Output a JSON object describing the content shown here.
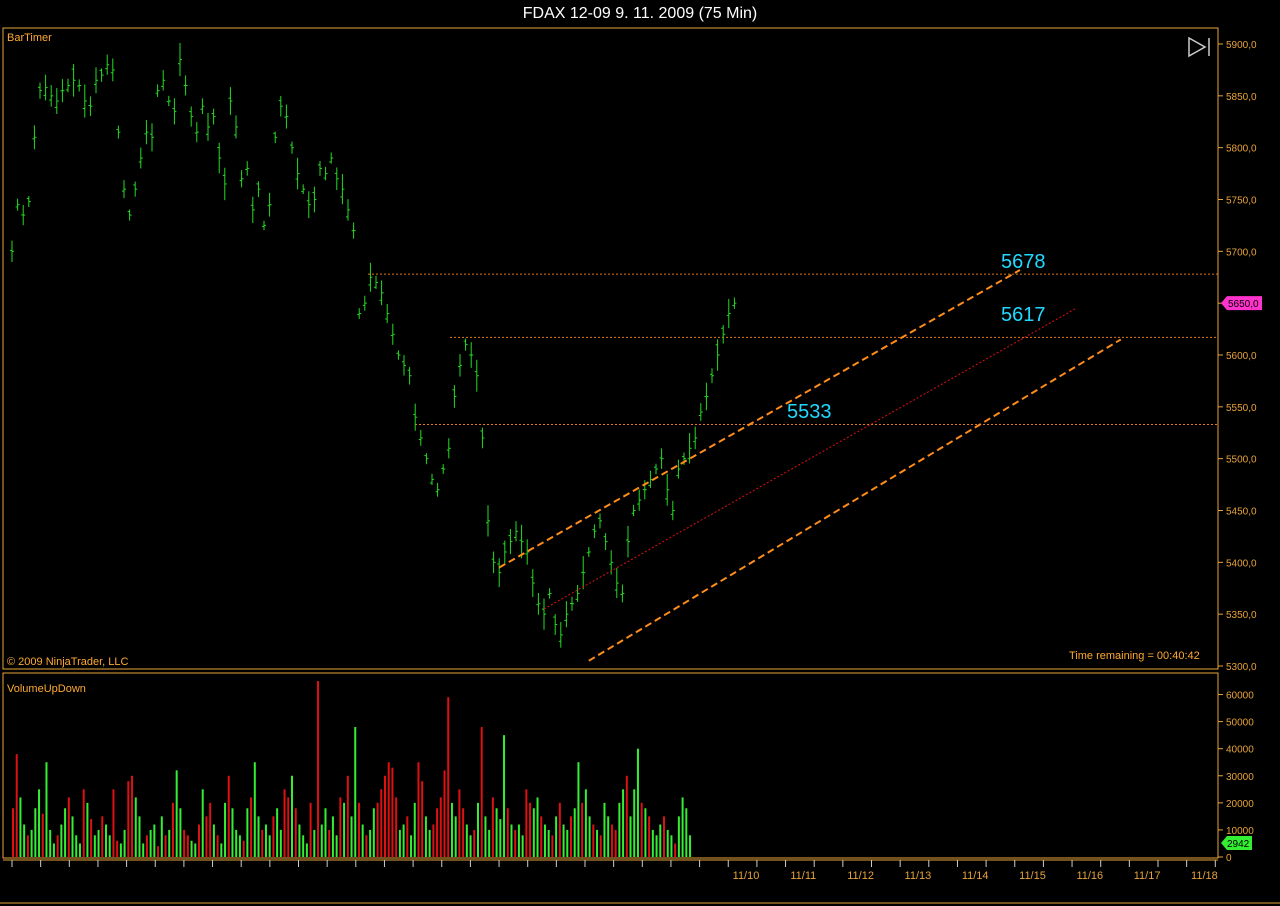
{
  "window": {
    "title": "FDAX 12-09  9. 11. 2009 (75 Min)"
  },
  "price_panel": {
    "indicator_label": "BarTimer",
    "copyright": "© 2009 NinjaTrader, LLC",
    "time_remaining": "Time remaining = 00:40:42",
    "current_price_marker": "5650,0",
    "level_labels": [
      "5678",
      "5617",
      "5533"
    ]
  },
  "volume_panel": {
    "indicator_label": "VolumeUpDown",
    "current_volume_marker": "2942"
  },
  "colors": {
    "up_bar": "#33ee33",
    "down_bar": "#dd1111",
    "price_line": "#22dd22",
    "axis": "#e8a33a",
    "level_line": "#e07a20",
    "channel": "#ff8c1a",
    "midline": "#dd1111",
    "level_label": "#22d8ff",
    "price_marker": "#ff33cc",
    "volume_marker": "#33ee33"
  },
  "icons": {
    "bar_timer_button": "play-to-end-icon"
  },
  "chart_data": [
    {
      "type": "line",
      "series": [
        {
          "values": [
            5700,
            5745,
            5735,
            5748,
            5810,
            5855,
            5858,
            5850,
            5845,
            5855,
            5860,
            5865,
            5860,
            5845,
            5840,
            5865,
            5870,
            5880,
            5875,
            5815,
            5760,
            5735,
            5760,
            5790,
            5815,
            5810,
            5855,
            5865,
            5845,
            5835,
            5885,
            5860,
            5830,
            5815,
            5840,
            5820,
            5830,
            5790,
            5765,
            5845,
            5820,
            5770,
            5780,
            5740,
            5760,
            5725,
            5745,
            5810,
            5840,
            5830,
            5800,
            5775,
            5760,
            5745,
            5750,
            5780,
            5775,
            5790,
            5770,
            5760,
            5740,
            5720,
            5640,
            5650,
            5675,
            5670,
            5660,
            5640,
            5620,
            5600,
            5590,
            5580,
            5540,
            5520,
            5500,
            5480,
            5470,
            5490,
            5510,
            5560,
            5590,
            5610,
            5600,
            5580,
            5520,
            5440,
            5400,
            5390,
            5410,
            5420,
            5430,
            5420,
            5410,
            5380,
            5360,
            5350,
            5370,
            5340,
            5330,
            5350,
            5360,
            5370,
            5390,
            5410,
            5430,
            5440,
            5420,
            5400,
            5380,
            5370,
            5420,
            5450,
            5460,
            5470,
            5480,
            5490,
            5500,
            5470,
            5450,
            5490,
            5500,
            5510,
            5520,
            5545,
            5560,
            5580,
            5600,
            5620,
            5640,
            5650
          ]
        }
      ],
      "ylim": [
        5300,
        5900
      ],
      "y_ticks": [
        "5900,0",
        "5850,0",
        "5800,0",
        "5750,0",
        "5700,0",
        "5650,0",
        "5600,0",
        "5550,0",
        "5500,0",
        "5450,0",
        "5400,0",
        "5350,0",
        "5300,0"
      ],
      "x_ticks": [
        "11/10",
        "11/11",
        "11/12",
        "11/13",
        "11/14",
        "11/15",
        "11/16",
        "11/17",
        "11/18"
      ],
      "horizontal_levels": [
        5678,
        5617,
        5533
      ],
      "channel": {
        "upper_line": [
          [
            87,
            5395
          ],
          [
            180,
            5682
          ]
        ],
        "mid_line": [
          [
            95,
            5355
          ],
          [
            190,
            5645
          ]
        ],
        "lower_line": [
          [
            103,
            5305
          ],
          [
            198,
            5615
          ]
        ]
      },
      "grid": false
    },
    {
      "type": "bar",
      "title": "VolumeUpDown",
      "series": [
        {
          "values": [
            18000,
            38000,
            22000,
            12000,
            8000,
            10000,
            18000,
            25000,
            16000,
            35000,
            10000,
            5000,
            8000,
            12000,
            18000,
            22000,
            15000,
            8000,
            5000,
            25000,
            20000,
            14000,
            8000,
            10000,
            15000,
            12000,
            8000,
            25000,
            6000,
            5000,
            10000,
            28000,
            30000,
            22000,
            15000,
            5000,
            8000,
            10000,
            12000,
            4000,
            15000,
            8000,
            10000,
            20000,
            32000,
            18000,
            10000,
            8000,
            6000,
            5000,
            12000,
            25000,
            15000,
            20000,
            12000,
            8000,
            5000,
            20000,
            30000,
            18000,
            10000,
            8000,
            6000,
            18000,
            22000,
            35000,
            15000,
            10000,
            12000,
            8000,
            15000,
            18000,
            10000,
            25000,
            22000,
            30000,
            18000,
            12000,
            8000,
            5000,
            20000,
            10000,
            65000,
            12000,
            18000,
            10000,
            15000,
            8000,
            22000,
            20000,
            30000,
            15000,
            48000,
            20000,
            12000,
            8000,
            10000,
            18000,
            20000,
            25000,
            30000,
            35000,
            33000,
            22000,
            10000,
            12000,
            15000,
            8000,
            20000,
            35000,
            28000,
            15000,
            10000,
            12000,
            18000,
            22000,
            32000,
            59000,
            20000,
            15000,
            25000,
            18000,
            12000,
            8000,
            10000,
            20000,
            48000,
            15000,
            10000,
            22000,
            18000,
            14000,
            45000,
            18000,
            12000,
            10000,
            12000,
            8000,
            25000,
            20000,
            18000,
            22000,
            15000,
            12000,
            10000,
            8000,
            15000,
            20000,
            12000,
            10000,
            15000,
            18000,
            35000,
            20000,
            25000,
            15000,
            12000,
            10000,
            8000,
            20000,
            15000,
            12000,
            10000,
            20000,
            25000,
            30000,
            15000,
            25000,
            40000,
            20000,
            18000,
            15000,
            10000,
            8000,
            12000,
            15000,
            10000,
            8000,
            5000,
            15000,
            22000,
            18000,
            8000
          ],
          "colors": [
            "down",
            "down",
            "up",
            "up",
            "down",
            "up",
            "up",
            "up",
            "down",
            "up",
            "up",
            "up",
            "down",
            "up",
            "up",
            "down",
            "up",
            "up",
            "up",
            "down",
            "up",
            "down",
            "up",
            "up",
            "down",
            "up",
            "up",
            "down",
            "down",
            "up",
            "up",
            "down",
            "down",
            "up",
            "up",
            "up",
            "down",
            "up",
            "up",
            "down",
            "up",
            "down",
            "up",
            "down",
            "up",
            "up",
            "down",
            "down",
            "up",
            "up",
            "down",
            "up",
            "down",
            "down",
            "up",
            "down",
            "up",
            "up",
            "down",
            "up",
            "up",
            "up",
            "down",
            "up",
            "down",
            "up",
            "up",
            "down",
            "up",
            "up",
            "down",
            "up",
            "up",
            "down",
            "down",
            "up",
            "down",
            "up",
            "up",
            "up",
            "down",
            "up",
            "down",
            "up",
            "up",
            "down",
            "up",
            "up",
            "down",
            "up",
            "down",
            "up",
            "up",
            "down",
            "up",
            "down",
            "up",
            "up",
            "down",
            "down",
            "down",
            "down",
            "down",
            "down",
            "up",
            "up",
            "down",
            "up",
            "up",
            "down",
            "down",
            "up",
            "up",
            "down",
            "down",
            "down",
            "down",
            "down",
            "up",
            "up",
            "down",
            "down",
            "up",
            "up",
            "down",
            "up",
            "down",
            "up",
            "up",
            "down",
            "up",
            "up",
            "up",
            "down",
            "up",
            "down",
            "up",
            "up",
            "down",
            "down",
            "up",
            "up",
            "down",
            "up",
            "up",
            "down",
            "up",
            "down",
            "up",
            "up",
            "down",
            "up",
            "up",
            "down",
            "up",
            "up",
            "down",
            "up",
            "down",
            "up",
            "up",
            "down",
            "down",
            "up",
            "up",
            "down",
            "up",
            "up",
            "up",
            "down",
            "up",
            "down",
            "up",
            "up",
            "up",
            "down",
            "up",
            "up",
            "down",
            "up",
            "up",
            "up",
            "up",
            "up",
            "up",
            "up"
          ]
        }
      ],
      "ylim": [
        0,
        65000
      ],
      "y_ticks": [
        "60000",
        "50000",
        "40000",
        "30000",
        "20000",
        "10000",
        "0"
      ]
    }
  ]
}
